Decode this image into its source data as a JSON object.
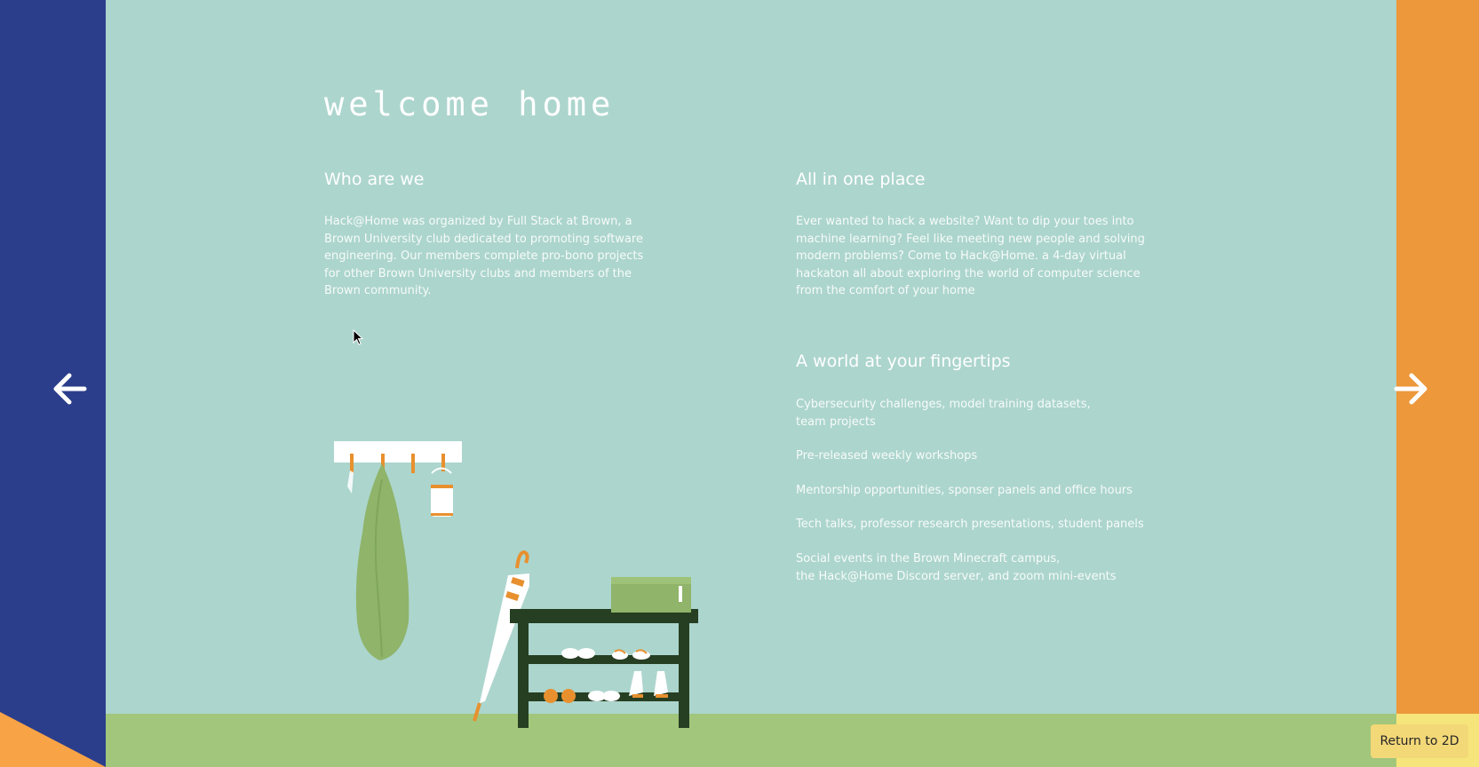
{
  "page": {
    "title": "welcome home"
  },
  "about": {
    "heading": "Who are we",
    "body": "Hack@Home was organized by Full Stack at Brown, a Brown University club dedicated to promoting software engineering. Our members complete pro-bono projects for other Brown University clubs and members of the Brown community."
  },
  "all_in_one": {
    "heading": "All in one place",
    "body": "Ever wanted to hack a website? Want to dip your toes into machine learning? Feel like meeting new people and solving modern problems? Come to Hack@Home. a 4-day virtual hackaton all about exploring the world of computer science from the comfort of your home"
  },
  "fingertips": {
    "heading": "A world at your fingertips",
    "items": [
      "Cybersecurity challenges, model training datasets,\nteam projects",
      "Pre-released weekly workshops",
      "Mentorship opportunities, sponser panels and office hours",
      "Tech talks, professor research presentations, student panels",
      "Social events in the Brown Minecraft campus,\nthe Hack@Home Discord server, and zoom mini-events"
    ]
  },
  "controls": {
    "return_label": "Return to 2D"
  },
  "icons": {
    "prev": "arrow-left-icon",
    "next": "arrow-right-icon",
    "cursor": "mouse-cursor-icon"
  },
  "colors": {
    "wall": "#acd5cd",
    "left_wall": "#2b3e8c",
    "right_wall": "#ec983b",
    "floor": "#a2c67b",
    "button": "#f3d878",
    "shelf": "#263f22",
    "coat": "#8fb46a",
    "hook": "#e8902e"
  }
}
